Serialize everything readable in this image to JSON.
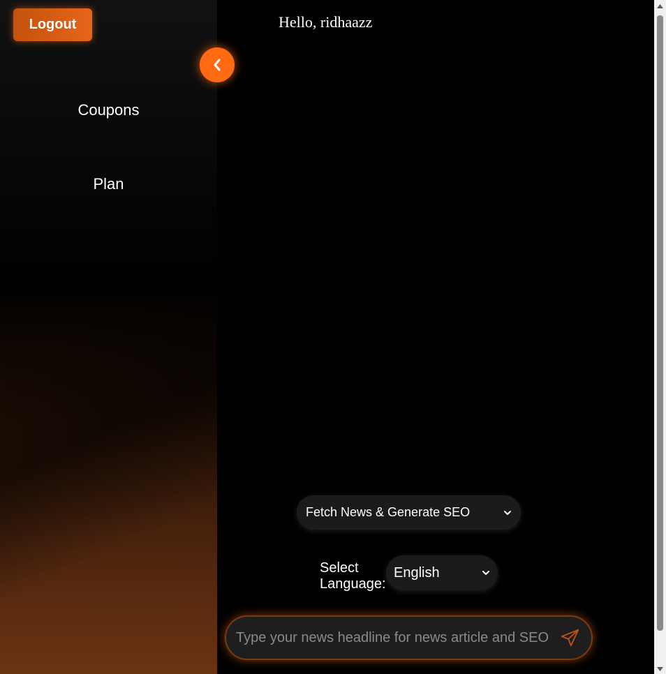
{
  "sidebar": {
    "logout_label": "Logout",
    "items": [
      {
        "label": "Coupons"
      },
      {
        "label": "Plan"
      }
    ],
    "collapse_icon": "chevron-left-icon"
  },
  "main": {
    "greeting": "Hello, ridhaazz",
    "mode_select": {
      "selected": "Fetch News & Generate SEO"
    },
    "language": {
      "label": "Select Language:",
      "selected": "English"
    },
    "headline_input": {
      "placeholder": "Type your news headline for news article and SEO",
      "value": ""
    },
    "send_icon": "send-icon"
  },
  "colors": {
    "accent": "#ff6a12",
    "logout_bg": "#d95d14",
    "background": "#000000",
    "field_bg": "#1b1b1b"
  }
}
